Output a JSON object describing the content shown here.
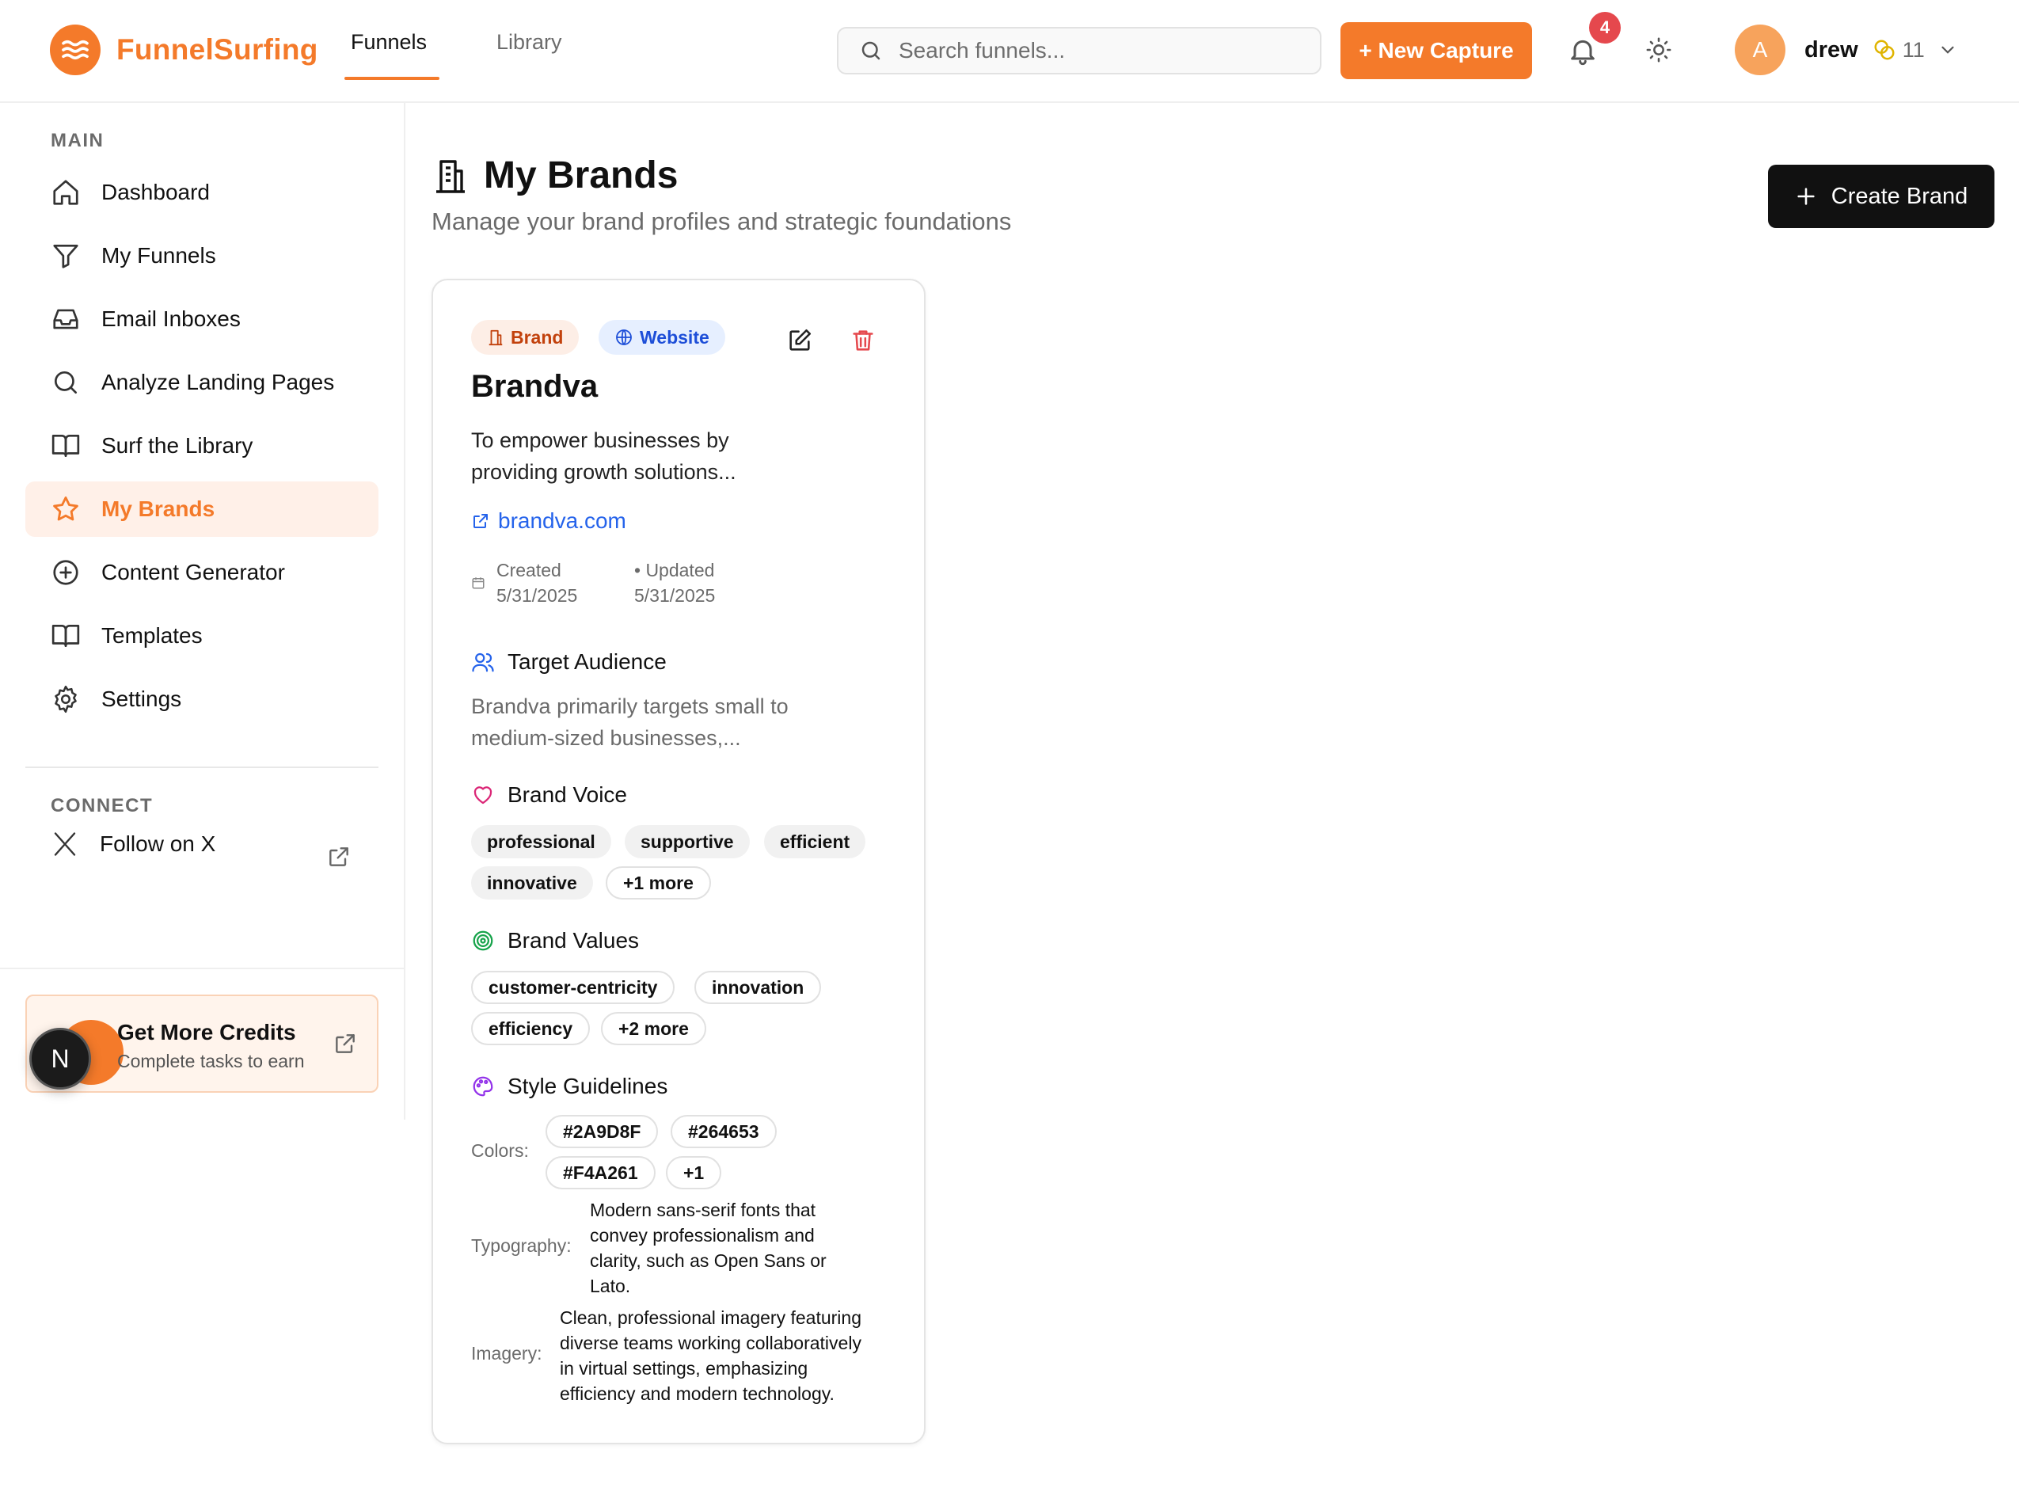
{
  "app": {
    "name": "FunnelSurfing"
  },
  "header": {
    "tabs": [
      {
        "label": "Funnels",
        "active": true
      },
      {
        "label": "Library",
        "active": false
      }
    ],
    "search_placeholder": "Search funnels...",
    "new_capture_label": "+ New Capture",
    "notification_count": "4",
    "user": {
      "initial": "A",
      "name": "drew",
      "credits": "11"
    }
  },
  "sidebar": {
    "main_label": "MAIN",
    "items": [
      {
        "label": "Dashboard",
        "icon": "home-icon"
      },
      {
        "label": "My Funnels",
        "icon": "funnel-icon"
      },
      {
        "label": "Email Inboxes",
        "icon": "inbox-icon"
      },
      {
        "label": "Analyze Landing Pages",
        "icon": "search-icon"
      },
      {
        "label": "Surf the Library",
        "icon": "book-icon"
      },
      {
        "label": "My Brands",
        "icon": "star-icon",
        "active": true
      },
      {
        "label": "Content Generator",
        "icon": "plus-circle-icon"
      },
      {
        "label": "Templates",
        "icon": "book-open-icon"
      },
      {
        "label": "Settings",
        "icon": "gear-icon"
      }
    ],
    "connect_label": "CONNECT",
    "follow_label": "Follow on X",
    "credits_card": {
      "title": "Get More Credits",
      "subtitle": "Complete tasks to earn"
    },
    "floating_badge": "N"
  },
  "main": {
    "title": "My Brands",
    "subtitle": "Manage your brand profiles and strategic foundations",
    "create_label": "Create Brand"
  },
  "brand_card": {
    "badges": {
      "brand": "Brand",
      "website": "Website"
    },
    "name": "Brandva",
    "mission_line1": "To empower businesses by",
    "mission_line2": "providing growth solutions...",
    "website": "brandva.com",
    "created_label": "Created",
    "created_date": "5/31/2025",
    "updated_label": "• Updated",
    "updated_date": "5/31/2025",
    "target_audience": {
      "heading": "Target Audience",
      "line1": "Brandva primarily targets small to",
      "line2": "medium-sized businesses,..."
    },
    "brand_voice": {
      "heading": "Brand Voice",
      "tags": [
        "professional",
        "supportive",
        "efficient",
        "innovative"
      ],
      "more": "+1 more"
    },
    "brand_values": {
      "heading": "Brand Values",
      "tags": [
        "customer-centricity",
        "innovation",
        "efficiency"
      ],
      "more": "+2 more"
    },
    "style_guidelines": {
      "heading": "Style Guidelines",
      "colors_label": "Colors:",
      "colors": [
        "#2A9D8F",
        "#264653",
        "#F4A261"
      ],
      "colors_more": "+1",
      "typography_label": "Typography:",
      "typography_lines": [
        "Modern sans-serif fonts that",
        "convey professionalism and",
        "clarity, such as Open Sans or",
        "Lato."
      ],
      "imagery_label": "Imagery:",
      "imagery_lines": [
        "Clean, professional imagery featuring",
        "diverse teams working collaboratively",
        "in virtual settings, emphasizing",
        "efficiency and modern technology."
      ]
    }
  },
  "colors": {
    "accent": "#f47a2a",
    "link": "#2563eb",
    "danger": "#e5484d"
  }
}
